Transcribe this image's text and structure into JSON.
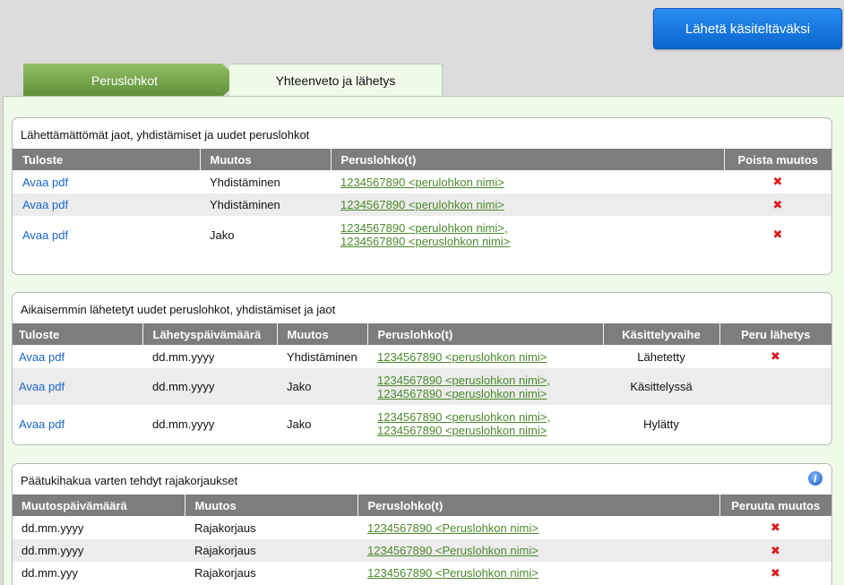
{
  "send_button": {
    "label": "Lähetä käsiteltäväksi"
  },
  "tabs": [
    {
      "label": "Peruslohkot",
      "active": true
    },
    {
      "label": "Yhteenveto ja lähetys",
      "active": false
    }
  ],
  "colors": {
    "tab_green": "#7aa84f",
    "send_blue": "#1a78e0",
    "remove_red": "#dd1a1a"
  },
  "panel1": {
    "title": "Lähettämättömät jaot, yhdistämiset ja uudet peruslohkot",
    "columns": [
      "Tuloste",
      "Muutos",
      "Peruslohko(t)",
      "Poista muutos"
    ],
    "rows": [
      {
        "tuloste": "Avaa pdf",
        "muutos": "Yhdistäminen",
        "lohko1": "1234567890 <perulohkon nimi>",
        "lohko2": "",
        "remove": "✖"
      },
      {
        "tuloste": "Avaa pdf",
        "muutos": "Yhdistäminen",
        "lohko1": "1234567890 <perulohkon nimi>",
        "lohko2": "",
        "remove": "✖"
      },
      {
        "tuloste": "Avaa pdf",
        "muutos": "Jako",
        "lohko1": "1234567890 <perulohkon nimi>,",
        "lohko2": "1234567890 <peruslohkon nimi>",
        "remove": "✖"
      }
    ]
  },
  "panel2": {
    "title": "Aikaisemmin lähetetyt uudet peruslohkot, yhdistämiset ja jaot",
    "columns": [
      "Tuloste",
      "Lähetyspäivämäärä",
      "Muutos",
      "Peruslohko(t)",
      "Käsittelyvaihe",
      "Peru lähetys"
    ],
    "rows": [
      {
        "tuloste": "Avaa pdf",
        "pvm": "dd.mm.yyyy",
        "muutos": "Yhdistäminen",
        "lohko1": "1234567890 <peruslohkon nimi>",
        "lohko2": "",
        "vaihe": "Lähetetty",
        "cancel": "✖"
      },
      {
        "tuloste": "Avaa pdf",
        "pvm": "dd.mm.yyyy",
        "muutos": "Jako",
        "lohko1": "1234567890 <peruslohkon nimi>,",
        "lohko2": "1234567890 <peruslohkon nimi>",
        "vaihe": "Käsittelyssä",
        "cancel": ""
      },
      {
        "tuloste": "Avaa pdf",
        "pvm": "dd.mm.yyyy",
        "muutos": "Jako",
        "lohko1": "1234567890 <peruslohkon nimi>,",
        "lohko2": "1234567890 <peruslohkon nimi>",
        "vaihe": "Hylätty",
        "cancel": ""
      }
    ]
  },
  "panel3": {
    "title": "Päätukihakua varten tehdyt rajakorjaukset",
    "info_icon": "i",
    "columns": [
      "Muutospäivämäärä",
      "Muutos",
      "Peruslohko(t)",
      "Peruuta muutos"
    ],
    "rows": [
      {
        "pvm": "dd.mm.yyyy",
        "muutos": "Rajakorjaus",
        "lohko": "1234567890 <Peruslohkon nimi>",
        "undo": "✖"
      },
      {
        "pvm": "dd.mm.yyyy",
        "muutos": "Rajakorjaus",
        "lohko": "1234567890 <Peruslohkon nimi>",
        "undo": "✖"
      },
      {
        "pvm": "dd.mm.yyy",
        "muutos": "Rajakorjaus",
        "lohko": "1234567890 <Peruslohkon nimi>",
        "undo": "✖"
      }
    ]
  }
}
